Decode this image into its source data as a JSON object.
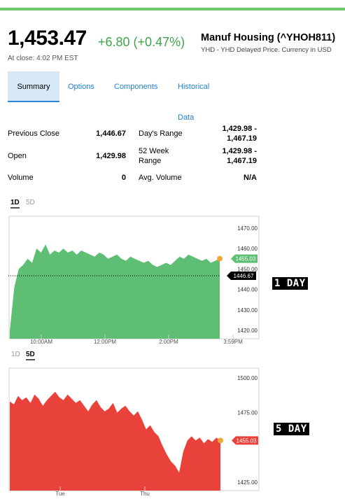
{
  "quote": {
    "price": "1,453.47",
    "change": "+6.80 (+0.47%)",
    "close_time": "At close: 4:02 PM EST",
    "name": "Manuf Housing (^YHOH811)",
    "subtitle": "YHD - YHD Delayed Price. Currency in USD"
  },
  "tabs": [
    "Summary",
    "Options",
    "Components",
    "Historical Data"
  ],
  "stats": {
    "prev_close_label": "Previous Close",
    "prev_close_value": "1,446.67",
    "open_label": "Open",
    "open_value": "1,429.98",
    "volume_label": "Volume",
    "volume_value": "0",
    "days_range_label": "Day's Range",
    "days_range_value_1": "1,429.98 -",
    "days_range_value_2": "1,467.19",
    "week52_label_1": "52 Week",
    "week52_label_2": "Range",
    "week52_value_1": "1,429.98 -",
    "week52_value_2": "1,467.19",
    "avg_volume_label": "Avg. Volume",
    "avg_volume_value": "N/A"
  },
  "chart1": {
    "range_tabs": [
      "1D",
      "5D"
    ],
    "active": "1D",
    "badge": "1 DAY",
    "y_ticks": [
      "1470.00",
      "1460.00",
      "1450.00",
      "1440.00",
      "1430.00",
      "1420.00"
    ],
    "x_ticks": [
      "10:00AM",
      "12:00PM",
      "2:00PM",
      "3:59PM"
    ],
    "last_price_label": "1455.03",
    "prev_close_label": "1446.67",
    "color": "#5ebe73"
  },
  "chart2": {
    "range_tabs": [
      "1D",
      "5D"
    ],
    "active": "5D",
    "badge": "5 DAY",
    "y_ticks": [
      "1500.00",
      "1475.00",
      "1425.00"
    ],
    "x_ticks": [
      "Tue",
      "Thu"
    ],
    "last_price_label": "1455.03",
    "color": "#e8423a"
  },
  "chart_data": [
    {
      "type": "area",
      "ylim": [
        1420,
        1472
      ],
      "y_ticks": [
        1470,
        1460,
        1450,
        1440,
        1430,
        1420
      ],
      "x": [
        "10:00AM",
        "12:00PM",
        "2:00PM",
        "3:59PM"
      ],
      "previous_close": 1446.67,
      "last": 1455.03,
      "values": [
        1420,
        1441,
        1450,
        1452,
        1455,
        1453,
        1460,
        1458,
        1462,
        1457,
        1459,
        1458,
        1460,
        1458,
        1459,
        1457,
        1459,
        1458,
        1457,
        1456,
        1458,
        1457,
        1455,
        1456,
        1457,
        1455,
        1454,
        1456,
        1455,
        1454,
        1453,
        1454,
        1452,
        1451,
        1452,
        1453,
        1452,
        1454,
        1456,
        1455,
        1457,
        1456,
        1455,
        1454,
        1455,
        1453,
        1454,
        1455.03
      ]
    },
    {
      "type": "area",
      "ylim": [
        1425,
        1502
      ],
      "y_ticks": [
        1500,
        1475,
        1425
      ],
      "x": [
        "Tue",
        "Thu"
      ],
      "last": 1455.03,
      "values": [
        1483,
        1481,
        1487,
        1484,
        1486,
        1482,
        1488,
        1485,
        1480,
        1484,
        1487,
        1490,
        1486,
        1484,
        1488,
        1485,
        1482,
        1484,
        1480,
        1476,
        1481,
        1484,
        1479,
        1476,
        1478,
        1482,
        1475,
        1478,
        1480,
        1476,
        1473,
        1476,
        1470,
        1463,
        1466,
        1461,
        1458,
        1451,
        1445,
        1440,
        1437,
        1432,
        1447,
        1455,
        1458,
        1455,
        1457,
        1453,
        1456,
        1454,
        1457,
        1455.03
      ]
    }
  ]
}
